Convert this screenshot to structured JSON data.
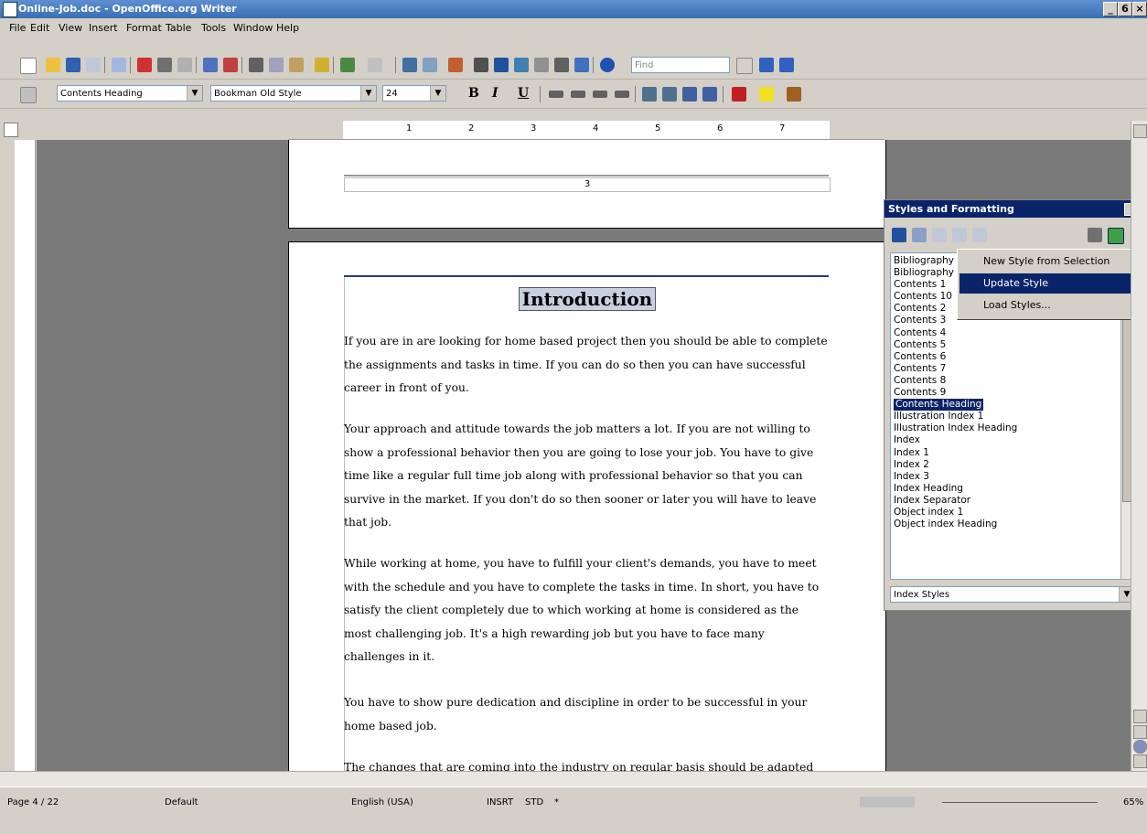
{
  "window": {
    "title": "Online-Job.doc - OpenOffice.org Writer",
    "min": "_",
    "restore": "6",
    "close": "×"
  },
  "menu": [
    "File",
    "Edit",
    "View",
    "Insert",
    "Format",
    "Table",
    "Tools",
    "Window",
    "Help"
  ],
  "find": {
    "placeholder": "Find"
  },
  "format": {
    "paragraph_style": "Contents Heading",
    "font_name": "Bookman Old Style",
    "font_size": "24",
    "bold": "B",
    "italic": "I",
    "underline": "U"
  },
  "ruler": {
    "ticks": [
      "1",
      "2",
      "3",
      "4",
      "5",
      "6",
      "7"
    ]
  },
  "page_prev": {
    "page_number": "3"
  },
  "document": {
    "heading": "Introduction",
    "paragraphs": [
      "If you are in are looking for home based project then you should be able to complete the assignments and tasks in time. If you can do so then you can have successful career in front of you.",
      "Your approach and attitude towards the job matters a lot. If you are not willing to show a professional behavior then you are going to lose your job. You have to give time like a regular full time job along with professional behavior so that you can survive in the market. If you don't do so then sooner or later you will have to leave that job.",
      "While working at home, you have to fulfill your client's demands, you have to meet with the schedule and you have to complete the tasks in time. In short, you have to satisfy the client completely due to which working at home is considered as the most challenging job. It's a high rewarding job but you have to face many challenges in it.",
      "You have to show pure dedication and discipline in order to be successful in your home based job.",
      "The changes that are coming into the industry on regular basis should be adapted by you as soon as possible so that you can meet with the"
    ]
  },
  "styles_panel": {
    "title": "Styles and Formatting",
    "styles": [
      "Bibliography ...",
      "Bibliography ...",
      "Contents 1",
      "Contents 10",
      "Contents 2",
      "Contents 3",
      "Contents 4",
      "Contents 5",
      "Contents 6",
      "Contents 7",
      "Contents 8",
      "Contents 9",
      "Contents Heading",
      "Illustration Index 1",
      "Illustration Index Heading",
      "Index",
      "Index 1",
      "Index 2",
      "Index 3",
      "Index Heading",
      "Index Separator",
      "Object index 1",
      "Object index Heading"
    ],
    "selected": "Contents Heading",
    "filter": "Index Styles"
  },
  "context_menu": [
    "New Style from Selection",
    "Update Style",
    "Load Styles..."
  ],
  "status": {
    "page": "Page 4 / 22",
    "page_style": "Default",
    "language": "English (USA)",
    "insert_mode": "INSRT",
    "selection_mode": "STD",
    "modified": "*",
    "zoom": "65%"
  }
}
